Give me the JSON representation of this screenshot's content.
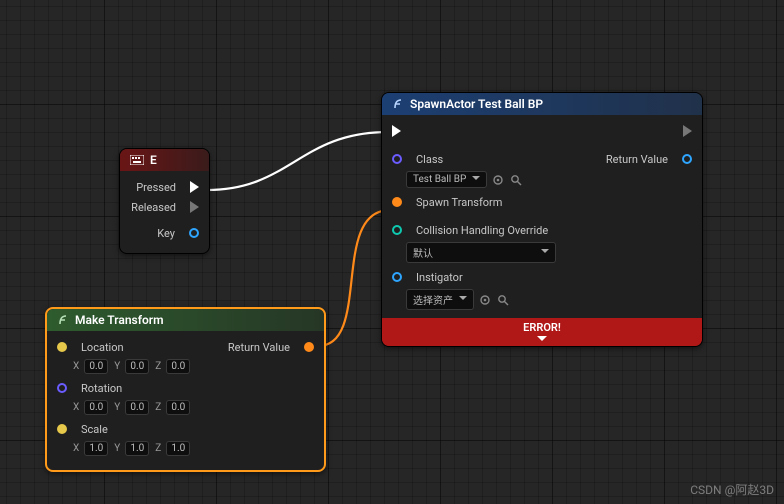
{
  "nodes": {
    "e": {
      "title": "E",
      "pins": {
        "pressed": "Pressed",
        "released": "Released",
        "key": "Key"
      }
    },
    "make_transform": {
      "title": "Make Transform",
      "location_label": "Location",
      "rotation_label": "Rotation",
      "scale_label": "Scale",
      "return_label": "Return Value",
      "location": {
        "x": "0.0",
        "y": "0.0",
        "z": "0.0"
      },
      "rotation": {
        "x": "0.0",
        "y": "0.0",
        "z": "0.0"
      },
      "scale": {
        "x": "1.0",
        "y": "1.0",
        "z": "1.0"
      }
    },
    "spawn": {
      "title": "SpawnActor Test Ball BP",
      "class_label": "Class",
      "class_value": "Test Ball BP",
      "spawn_transform_label": "Spawn Transform",
      "collision_label": "Collision Handling Override",
      "collision_value": "默认",
      "instigator_label": "Instigator",
      "instigator_value": "选择资产",
      "return_label": "Return Value",
      "error": "ERROR!"
    }
  },
  "axes": {
    "x": "X",
    "y": "Y",
    "z": "Z"
  },
  "watermark": "CSDN @阿赵3D"
}
